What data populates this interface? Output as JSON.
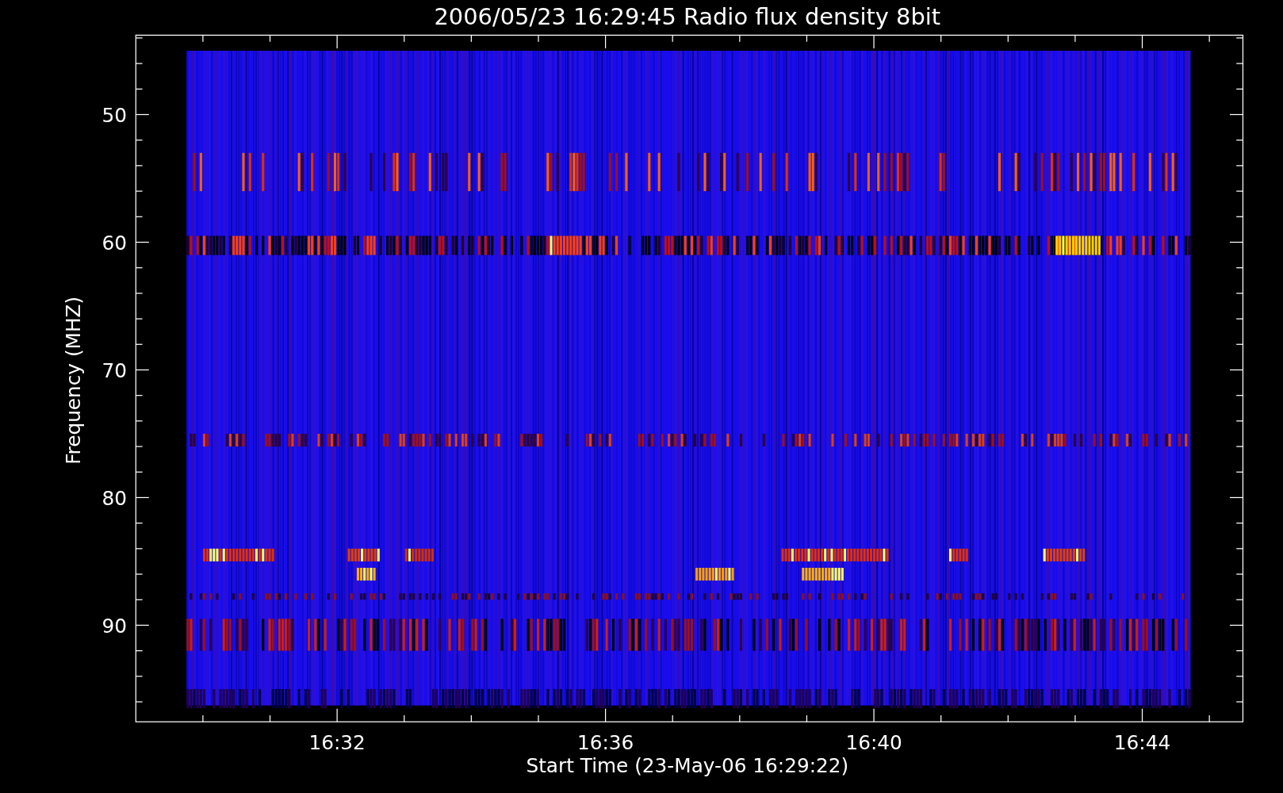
{
  "plot": {
    "title": "2006/05/23 16:29:45 Radio flux density 8bit",
    "y_axis": {
      "label": "Frequency (MHZ)",
      "tick_labels": [
        "50",
        "60",
        "70",
        "80",
        "90"
      ]
    },
    "x_axis": {
      "label": "Start Time (23-May-06 16:29:22)",
      "tick_labels": [
        "16:32",
        "16:36",
        "16:40",
        "16:44"
      ]
    }
  }
}
